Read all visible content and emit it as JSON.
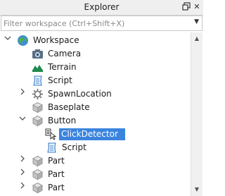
{
  "panel": {
    "title": "Explorer"
  },
  "filter": {
    "placeholder": "Filter workspace (Ctrl+Shift+X)"
  },
  "tree": [
    {
      "label": "Workspace",
      "icon": "globe-icon",
      "expander": "expanded"
    },
    {
      "label": "Camera",
      "icon": "camera-icon",
      "expander": "none"
    },
    {
      "label": "Terrain",
      "icon": "terrain-icon",
      "expander": "none"
    },
    {
      "label": "Script",
      "icon": "script-icon",
      "expander": "none"
    },
    {
      "label": "SpawnLocation",
      "icon": "spawn-icon",
      "expander": "collapsed"
    },
    {
      "label": "Baseplate",
      "icon": "part-icon",
      "expander": "none"
    },
    {
      "label": "Button",
      "icon": "part-icon",
      "expander": "expanded"
    },
    {
      "label": "ClickDetector",
      "icon": "click-detector-icon",
      "expander": "none",
      "selected": true
    },
    {
      "label": "Script",
      "icon": "script-icon",
      "expander": "none"
    },
    {
      "label": "Part",
      "icon": "part-icon",
      "expander": "collapsed"
    },
    {
      "label": "Part",
      "icon": "part-icon",
      "expander": "collapsed"
    },
    {
      "label": "Part",
      "icon": "part-icon",
      "expander": "collapsed"
    }
  ],
  "colors": {
    "selection": "#3a84de",
    "header": "#efefef"
  }
}
